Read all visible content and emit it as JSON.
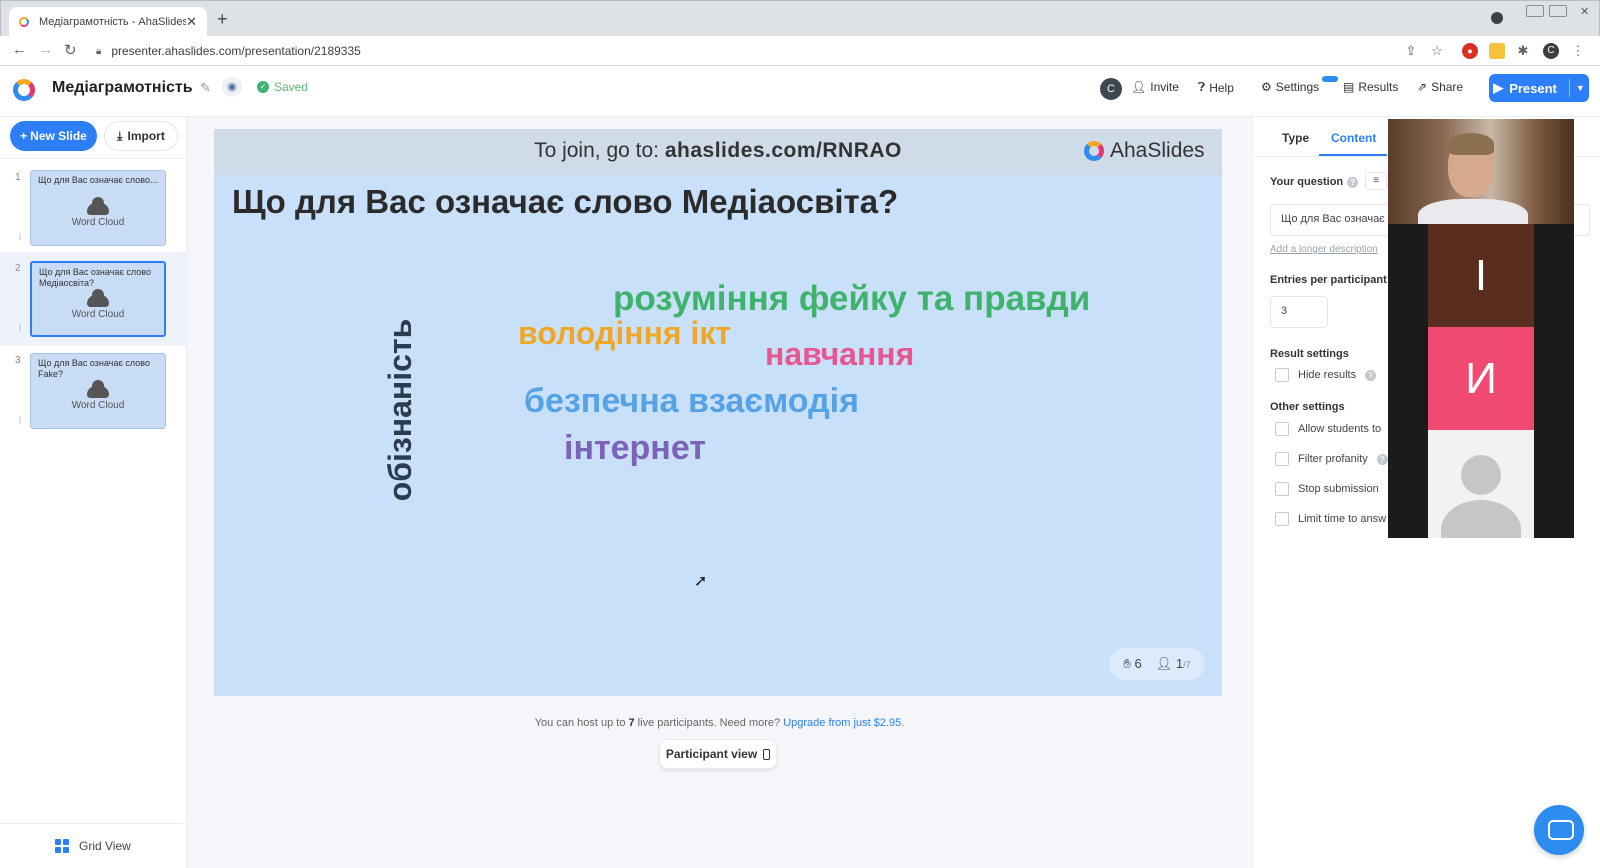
{
  "browser": {
    "tab_title": "Медіаграмотність - AhaSlides",
    "url": "presenter.ahaslides.com/presentation/2189335",
    "profile_initial": "C"
  },
  "header": {
    "title": "Медіаграмотність",
    "saved_label": "Saved",
    "user_initial": "C",
    "invite": "Invite",
    "help": "Help",
    "settings": "Settings",
    "results": "Results",
    "share": "Share",
    "present": "Present"
  },
  "sidebar": {
    "new_slide": "New Slide",
    "import": "Import",
    "grid_view": "Grid View",
    "slides": [
      {
        "number": "1",
        "question": "Що для Вас означає слово...",
        "type": "Word Cloud"
      },
      {
        "number": "2",
        "question": "Що для Вас означає слово Медіаосвіта?",
        "type": "Word Cloud"
      },
      {
        "number": "3",
        "question": "Що для Вас означає слово Fake?",
        "type": "Word Cloud"
      }
    ]
  },
  "slide": {
    "join_prefix": "To join, go to: ",
    "join_url": "ahaslides.com/RNRAO",
    "brand": "AhaSlides",
    "question": "Що для Вас означає слово Медіаосвіта?",
    "words": [
      {
        "text": "розуміння фейку та правди",
        "color": "#3fb26c"
      },
      {
        "text": "володіння ікт",
        "color": "#f0a726"
      },
      {
        "text": "навчання",
        "color": "#e8568f"
      },
      {
        "text": "безпечна взаємодія",
        "color": "#56a2e6"
      },
      {
        "text": "інтернет",
        "color": "#7b63b8"
      },
      {
        "text": "обізнаність",
        "color": "#2d3b4e"
      }
    ],
    "responses_count": "6",
    "participants_count": "1",
    "participants_max": "/7"
  },
  "footer": {
    "upgrade_prefix": "You can host up to ",
    "upgrade_limit": "7",
    "upgrade_mid": " live participants. Need more? ",
    "upgrade_link": "Upgrade from just $2.95",
    "upgrade_suffix": ".",
    "participant_view": "Participant view"
  },
  "right_panel": {
    "tab_type": "Type",
    "tab_content": "Content",
    "your_question": "Your question",
    "question_value": "Що для Вас означає",
    "longer_description": "Add a longer description",
    "entries_label": "Entries per participant",
    "entries_value": "3",
    "result_settings": "Result settings",
    "hide_results": "Hide results",
    "other_settings": "Other settings",
    "allow_students": "Allow students to",
    "filter_profanity": "Filter profanity",
    "stop_submission": "Stop submission",
    "limit_time": "Limit time to answ"
  },
  "video": {
    "tile1_letter": "І",
    "tile2_letter": "И"
  },
  "colors": {
    "accent": "#2d7ff9",
    "slide_bg": "#c9e0fa",
    "saved": "#3cb371"
  }
}
